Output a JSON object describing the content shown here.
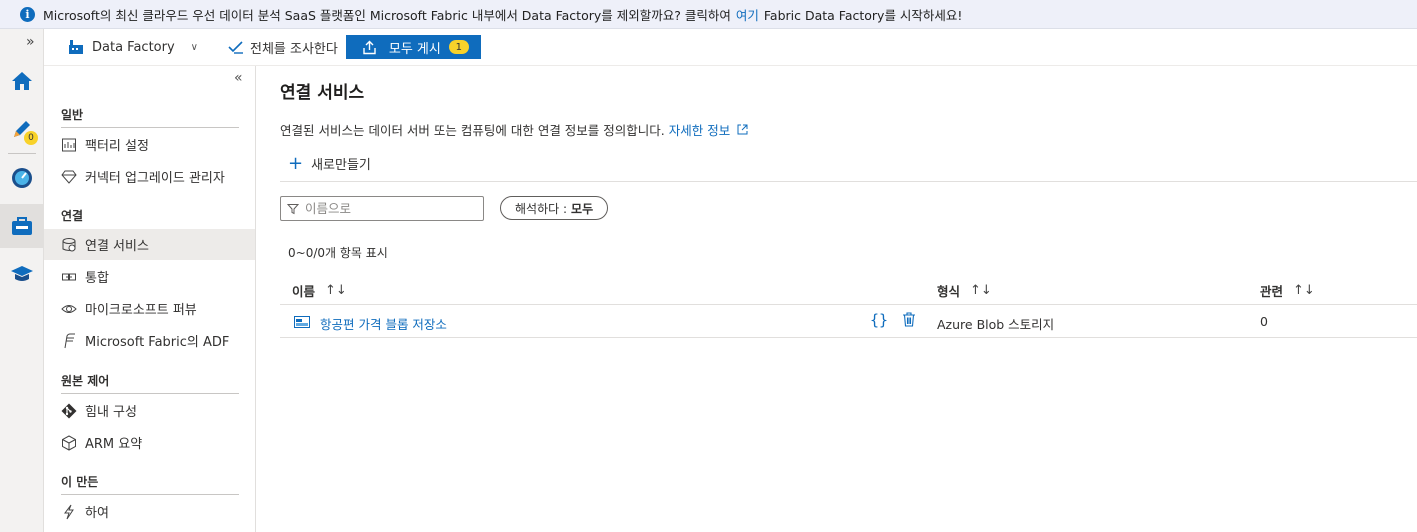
{
  "banner": {
    "icon": "info-icon",
    "text_before": "Microsoft의 최신 클라우드 우선 데이터 분석 SaaS 플랫폼인 Microsoft Fabric 내부에서 Data Factory를 제외할까요? 클릭하여",
    "link": "여기",
    "text_after": "Fabric Data Factory를 시작하세요!"
  },
  "toolbar": {
    "factory_label": "Data Factory",
    "validate_label": "전체를 조사한다",
    "publish_label": "모두 게시",
    "publish_count": "1"
  },
  "rail": {
    "author_badge": "0",
    "items": [
      "home-icon",
      "author-icon",
      "monitor-icon",
      "manage-icon",
      "learn-icon"
    ]
  },
  "sidenav": {
    "sections": {
      "general": "일반",
      "connections": "연결",
      "source_control": "원본 제어",
      "author": "이 만든"
    },
    "items": {
      "factory_settings": "팩터리 설정",
      "connector_upgrade": "커넥터 업그레이드 관리자",
      "linked_services": "연결 서비스",
      "integration": "통합",
      "purview": "마이크로소프트 퍼뷰",
      "fabric_adf": "Microsoft Fabric의 ADF",
      "git": "힘내 구성",
      "arm": "ARM 요약",
      "triggers": "하여"
    }
  },
  "main": {
    "title": "연결 서비스",
    "description": "연결된 서비스는 데이터 서버 또는 컴퓨팅에 대한 연결 정보를 정의합니다.",
    "learn_more": "자세한 정보",
    "new_label": "새로만들기",
    "filter_placeholder": "이름으로",
    "type_filter_label": "해석하다 :",
    "type_filter_value": "모두",
    "count_text": "0~0/0개 항목 표시",
    "columns": {
      "name": "이름",
      "type": "형식",
      "related": "관련"
    },
    "rows": [
      {
        "name": "항공편 가격 블롭 저장소",
        "type": "Azure Blob 스토리지",
        "related": "0"
      }
    ]
  },
  "colors": {
    "accent": "#0f6cbd",
    "badge": "#f8d22a",
    "banner_bg": "#eef0f9"
  }
}
